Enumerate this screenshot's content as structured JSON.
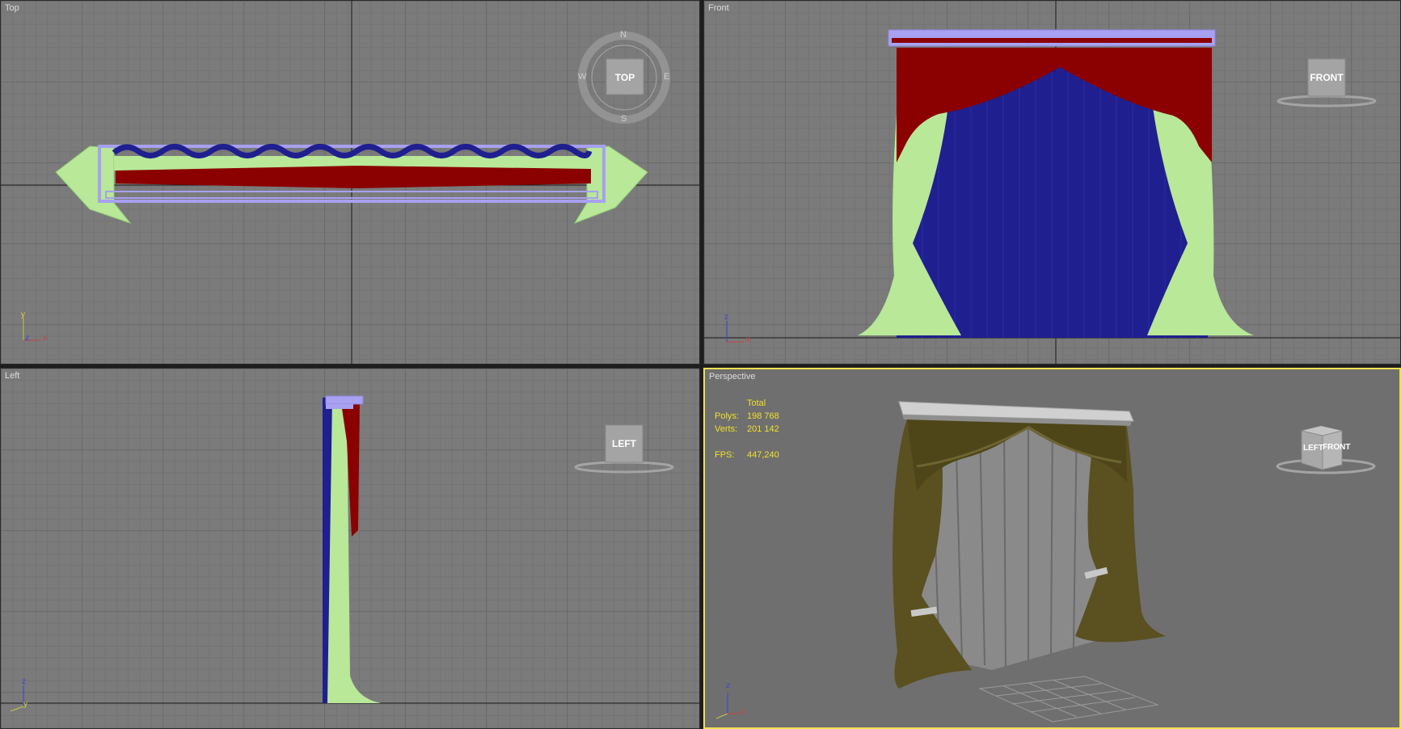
{
  "viewports": {
    "top": {
      "label": "Top",
      "cube": "TOP",
      "compass": {
        "n": "N",
        "s": "S",
        "e": "E",
        "w": "W"
      }
    },
    "front": {
      "label": "Front",
      "cube": "FRONT"
    },
    "left": {
      "label": "Left",
      "cube": "LEFT"
    },
    "perspective": {
      "label": "Perspective",
      "cube_left": "LEFT",
      "cube_front": "FRONT"
    }
  },
  "axes": {
    "x": "x",
    "y": "y",
    "z": "z"
  },
  "stats": {
    "header": "Total",
    "polys_label": "Polys:",
    "polys_value": "198 768",
    "verts_label": "Verts:",
    "verts_value": "201 142",
    "fps_label": "FPS:",
    "fps_value": "447,240"
  },
  "colors": {
    "viewport_bg": "#7b7b7b",
    "grid": "#6b6b6b",
    "valance": "#8b0000",
    "drape": "#b8e898",
    "sheer": "#1f1f8f",
    "cornice": "#a8a0f0",
    "active_border": "#f0e050",
    "stats_text": "#f0e02a",
    "olive_fabric": "#5a5020"
  }
}
